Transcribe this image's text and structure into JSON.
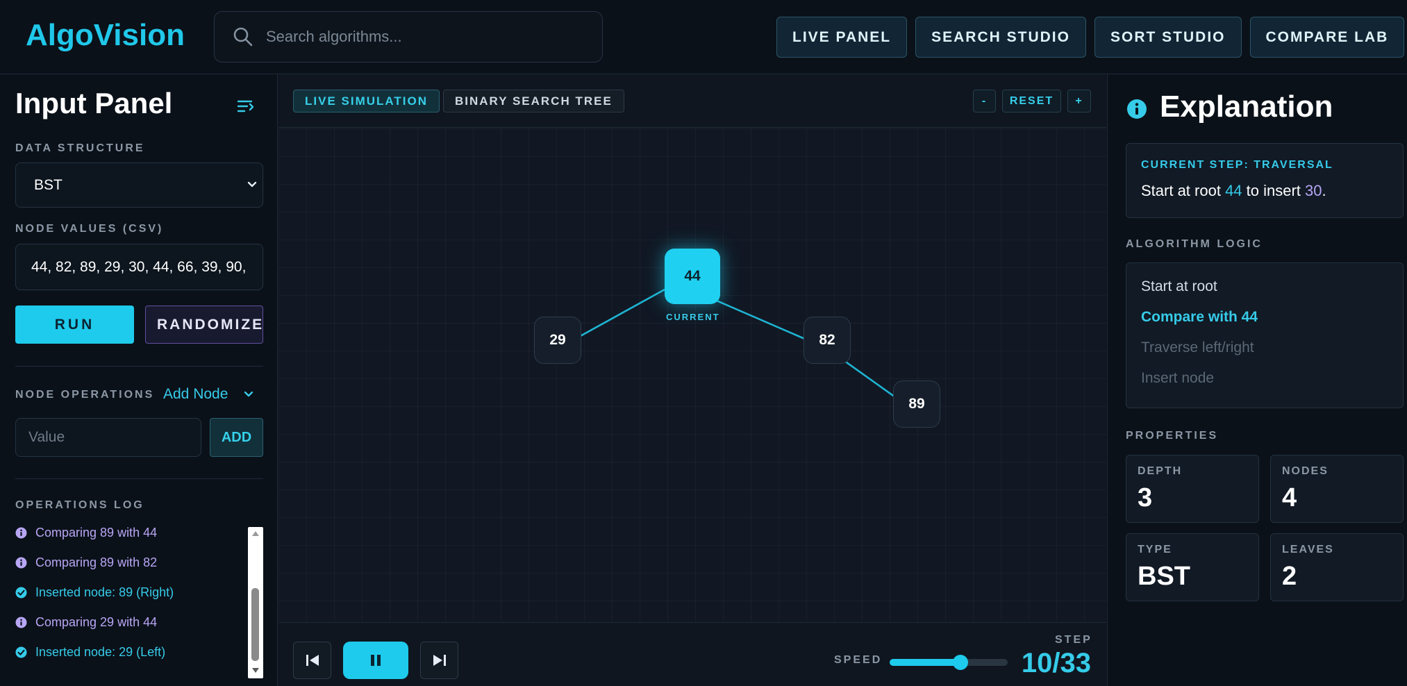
{
  "header": {
    "logo": "AlgoVision",
    "search_placeholder": "Search algorithms...",
    "nav": [
      "LIVE PANEL",
      "SEARCH STUDIO",
      "SORT STUDIO",
      "COMPARE LAB"
    ]
  },
  "input_panel": {
    "title": "Input Panel",
    "data_structure_label": "DATA STRUCTURE",
    "data_structure_value": "BST",
    "node_values_label": "NODE VALUES (CSV)",
    "node_values_value": "44, 82, 89, 29, 30, 44, 66, 39, 90,",
    "run_label": "RUN",
    "randomize_label": "RANDOMIZE",
    "node_operations_label": "NODE OPERATIONS",
    "node_operation_value": "Add Node",
    "value_placeholder": "Value",
    "add_label": "ADD",
    "operations_log_label": "OPERATIONS LOG",
    "log": [
      {
        "type": "info",
        "text": "Comparing 89 with 44"
      },
      {
        "type": "info",
        "text": "Comparing 89 with 82"
      },
      {
        "type": "success",
        "text": "Inserted node: 89 (Right)"
      },
      {
        "type": "info",
        "text": "Comparing 29 with 44"
      },
      {
        "type": "success",
        "text": "Inserted node: 29 (Left)"
      }
    ]
  },
  "canvas": {
    "tags": {
      "live": "LIVE SIMULATION",
      "structure": "BINARY SEARCH TREE"
    },
    "zoom": {
      "minus": "-",
      "reset": "RESET",
      "plus": "+"
    },
    "nodes": [
      {
        "value": "44",
        "current": true,
        "caption": "CURRENT"
      },
      {
        "value": "29",
        "current": false
      },
      {
        "value": "82",
        "current": false
      },
      {
        "value": "89",
        "current": false
      }
    ],
    "speed_label": "SPEED",
    "speed_fraction": 0.6,
    "step_label": "STEP",
    "step_value": "10/33"
  },
  "explanation": {
    "title": "Explanation",
    "current_step_label": "CURRENT STEP: TRAVERSAL",
    "current_step_text": {
      "a": "Start at root ",
      "b": "44",
      "c": " to insert ",
      "d": "30",
      "e": "."
    },
    "algorithm_logic_label": "ALGORITHM LOGIC",
    "logic": [
      {
        "text": "Start at root",
        "state": "done"
      },
      {
        "text": "Compare with 44",
        "state": "active"
      },
      {
        "text": "Traverse left/right",
        "state": "pending"
      },
      {
        "text": "Insert node",
        "state": "pending"
      }
    ],
    "properties_label": "PROPERTIES",
    "properties": [
      {
        "label": "DEPTH",
        "value": "3"
      },
      {
        "label": "NODES",
        "value": "4"
      },
      {
        "label": "TYPE",
        "value": "BST"
      },
      {
        "label": "LEAVES",
        "value": "2"
      }
    ]
  },
  "colors": {
    "accent": "#1ecbec",
    "info": "#b8a6f5",
    "success": "#36cbe9"
  }
}
